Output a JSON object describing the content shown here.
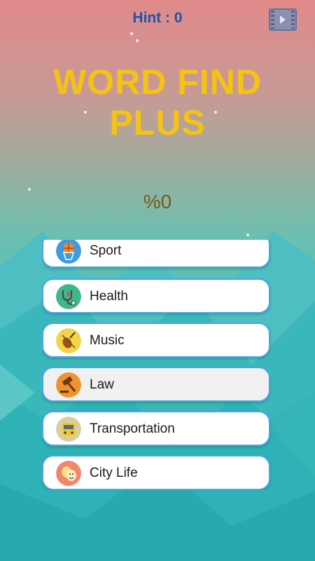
{
  "header": {
    "hint_text": "Hint : 0",
    "video_icon": "video-film-icon"
  },
  "title": {
    "line1": "WORD FIND",
    "line2": "PLUS"
  },
  "progress": "%0",
  "categories": [
    {
      "label": "Sport",
      "icon": "basketball-icon",
      "color": "#3f9be0"
    },
    {
      "label": "Health",
      "icon": "stethoscope-icon",
      "color": "#3fb78c"
    },
    {
      "label": "Music",
      "icon": "violin-icon",
      "color": "#f3d34a"
    },
    {
      "label": "Law",
      "icon": "gavel-icon",
      "color": "#f0922e"
    },
    {
      "label": "Transportation",
      "icon": "bus-icon",
      "color": "#d9cf9c"
    },
    {
      "label": "City Life",
      "icon": "theater-masks-icon",
      "color": "#f2856a"
    }
  ],
  "colors": {
    "title": "#f5c314",
    "hint": "#1f52a9",
    "item_border": "#4aa6e3"
  }
}
